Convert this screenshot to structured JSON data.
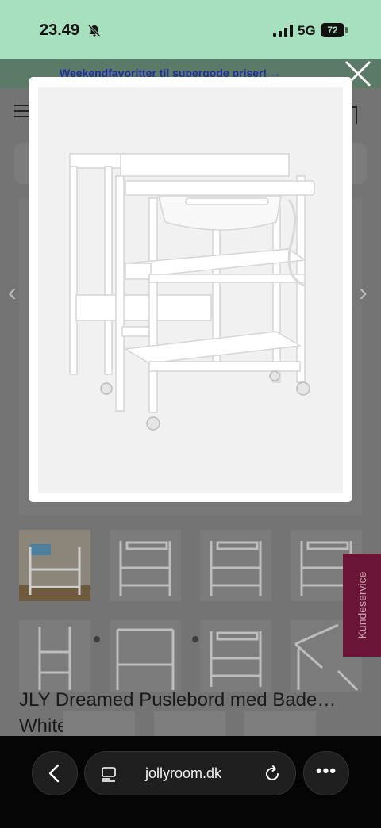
{
  "status_bar": {
    "time": "23.49",
    "network": "5G",
    "battery": "72"
  },
  "promo": {
    "text": "Weekendfavoritter til supergode priser! →"
  },
  "product": {
    "title": "JLY Dreamed Puslebord med Bade… White"
  },
  "support": {
    "label": "Kundeservice"
  },
  "browser": {
    "url": "jollyroom.dk"
  },
  "icons": {
    "close": "close-icon",
    "back": "chevron-left-icon",
    "reload": "reload-icon",
    "more": "ellipsis-icon",
    "page": "page-icon",
    "bell": "bell-muted-icon"
  },
  "colors": {
    "status_bg": "#a7e0bf",
    "promo_link": "#1e2fa0",
    "support_bg": "#6a1535"
  }
}
